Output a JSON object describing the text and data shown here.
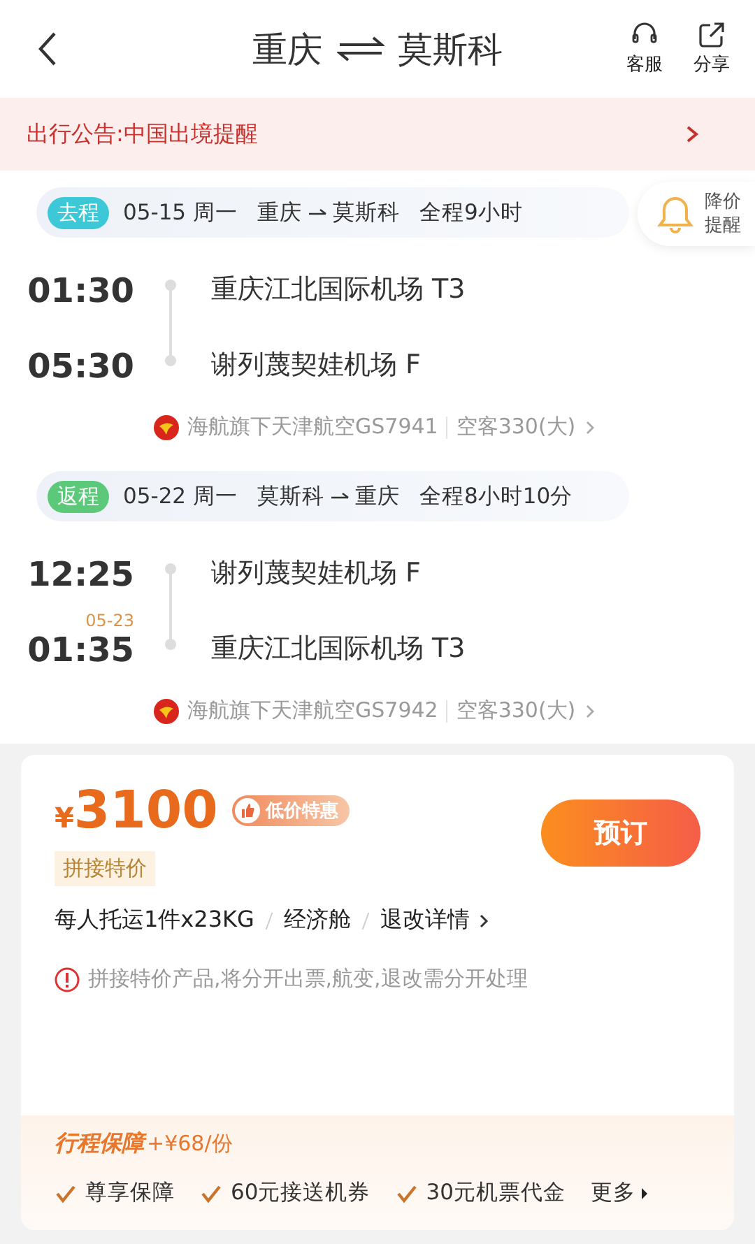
{
  "header": {
    "from": "重庆",
    "to": "莫斯科",
    "actions": [
      {
        "kind": "service",
        "label": "客服"
      },
      {
        "kind": "share",
        "label": "分享"
      }
    ]
  },
  "notice": {
    "text": "出行公告:中国出境提醒"
  },
  "price_alert": {
    "label_1": "降价",
    "label_2": "提醒"
  },
  "legs": [
    {
      "tag": "去程",
      "color": "#3cc8d6",
      "date": "05-15 周一",
      "route_from": "重庆",
      "route_to": "莫斯科",
      "duration": "全程9小时",
      "stops": [
        {
          "time": "01:30",
          "airport": "重庆江北国际机场 T3"
        },
        {
          "time": "05:30",
          "airport": "谢列蔑契娃机场 F"
        }
      ],
      "airline": "海航旗下天津航空GS7941",
      "aircraft": "空客330(大)"
    },
    {
      "tag": "返程",
      "color": "#5cc97a",
      "date": "05-22 周一",
      "route_from": "莫斯科",
      "route_to": "重庆",
      "duration": "全程8小时10分",
      "stops": [
        {
          "time": "12:25",
          "airport": "谢列蔑契娃机场 F"
        },
        {
          "time": "01:35",
          "date_note": "05-23",
          "airport": "重庆江北国际机场 T3"
        }
      ],
      "airline": "海航旗下天津航空GS7942",
      "aircraft": "空客330(大)"
    }
  ],
  "offer": {
    "currency": "¥",
    "price": "3100",
    "badge": "低价特惠",
    "book_button": "预订",
    "tag": "拼接特价",
    "details": [
      "每人托运1件x23KG",
      "经济舱",
      "退改详情"
    ],
    "warning": "拼接特价产品,将分开出票,航变,退改需分开处理",
    "insurance_title": "行程保障",
    "insurance_price": "+¥68/份",
    "perks": [
      "尊享保障",
      "60元接送机券",
      "30元机票代金"
    ],
    "more": "更多"
  }
}
